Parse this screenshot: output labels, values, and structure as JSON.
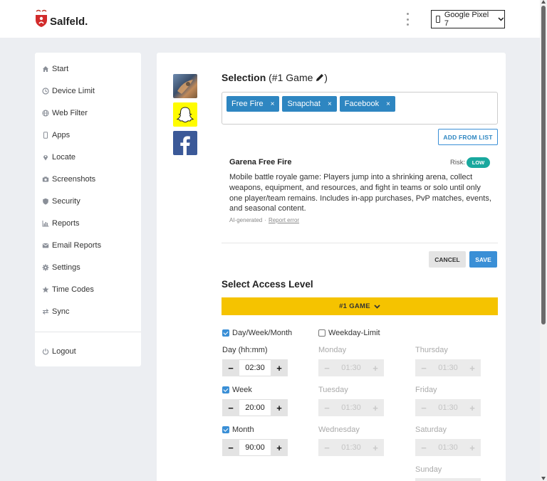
{
  "header": {
    "logo_text": "Salfeld.",
    "device": "Google Pixel 7",
    "icons": {
      "logo": "salfeld-shield-logo",
      "menu": "kebab-menu-icon",
      "device": "phone-icon",
      "dropdown": "chevron-down-icon"
    }
  },
  "sidebar": {
    "items": [
      {
        "label": "Start",
        "icon": "home-icon"
      },
      {
        "label": "Device Limit",
        "icon": "clock-icon"
      },
      {
        "label": "Web Filter",
        "icon": "globe-icon"
      },
      {
        "label": "Apps",
        "icon": "phone-icon"
      },
      {
        "label": "Locate",
        "icon": "map-pin-icon"
      },
      {
        "label": "Screenshots",
        "icon": "camera-icon"
      },
      {
        "label": "Security",
        "icon": "shield-icon"
      },
      {
        "label": "Reports",
        "icon": "chart-icon"
      },
      {
        "label": "Email Reports",
        "icon": "envelope-icon"
      },
      {
        "label": "Settings",
        "icon": "gear-icon"
      },
      {
        "label": "Time Codes",
        "icon": "star-icon"
      },
      {
        "label": "Sync",
        "icon": "sync-icon"
      }
    ],
    "logout": {
      "label": "Logout",
      "icon": "power-icon"
    }
  },
  "selection": {
    "title": "Selection",
    "subtitle_prefix": "(#1 Game",
    "subtitle_suffix": ")",
    "edit_icon": "pencil-icon",
    "app_icons": [
      "free-fire-app-icon",
      "snapchat-app-icon",
      "facebook-app-icon"
    ],
    "tags": [
      {
        "label": "Free Fire",
        "remove": "×"
      },
      {
        "label": "Snapchat",
        "remove": "×"
      },
      {
        "label": "Facebook",
        "remove": "×"
      }
    ],
    "add_from_list": "ADD FROM LIST"
  },
  "app_info": {
    "name": "Garena Free Fire",
    "risk_label": "Risk:",
    "risk_value": "LOW",
    "risk_color": "#19a89e",
    "description": "Mobile battle royale game: Players jump into a shrinking arena, collect weapons, equipment, and resources, and fight in teams or solo until only one player/team remains. Includes in-app purchases, PvP matches, events, and seasonal content.",
    "ai_label": "AI-generated",
    "separator": "·",
    "report_link": "Report error"
  },
  "actions": {
    "cancel": "CANCEL",
    "save": "SAVE"
  },
  "access": {
    "title": "Select Access Level",
    "level": "#1 GAME",
    "level_color": "#f5c300",
    "day_week_month": {
      "label": "Day/Week/Month",
      "checked": true
    },
    "weekday_limit": {
      "label": "Weekday-Limit",
      "checked": false
    },
    "day_label": "Day (hh:mm)",
    "day_value": "02:30",
    "week": {
      "label": "Week",
      "checked": true,
      "value": "20:00"
    },
    "month": {
      "label": "Month",
      "checked": true,
      "value": "90:00"
    },
    "weekdays": [
      {
        "label": "Monday",
        "value": "01:30"
      },
      {
        "label": "Tuesday",
        "value": "01:30"
      },
      {
        "label": "Wednesday",
        "value": "01:30"
      },
      {
        "label": "Thursday",
        "value": "01:30"
      },
      {
        "label": "Friday",
        "value": "01:30"
      },
      {
        "label": "Saturday",
        "value": "01:30"
      },
      {
        "label": "Sunday",
        "value": ""
      }
    ],
    "minus": "−",
    "plus": "+"
  }
}
